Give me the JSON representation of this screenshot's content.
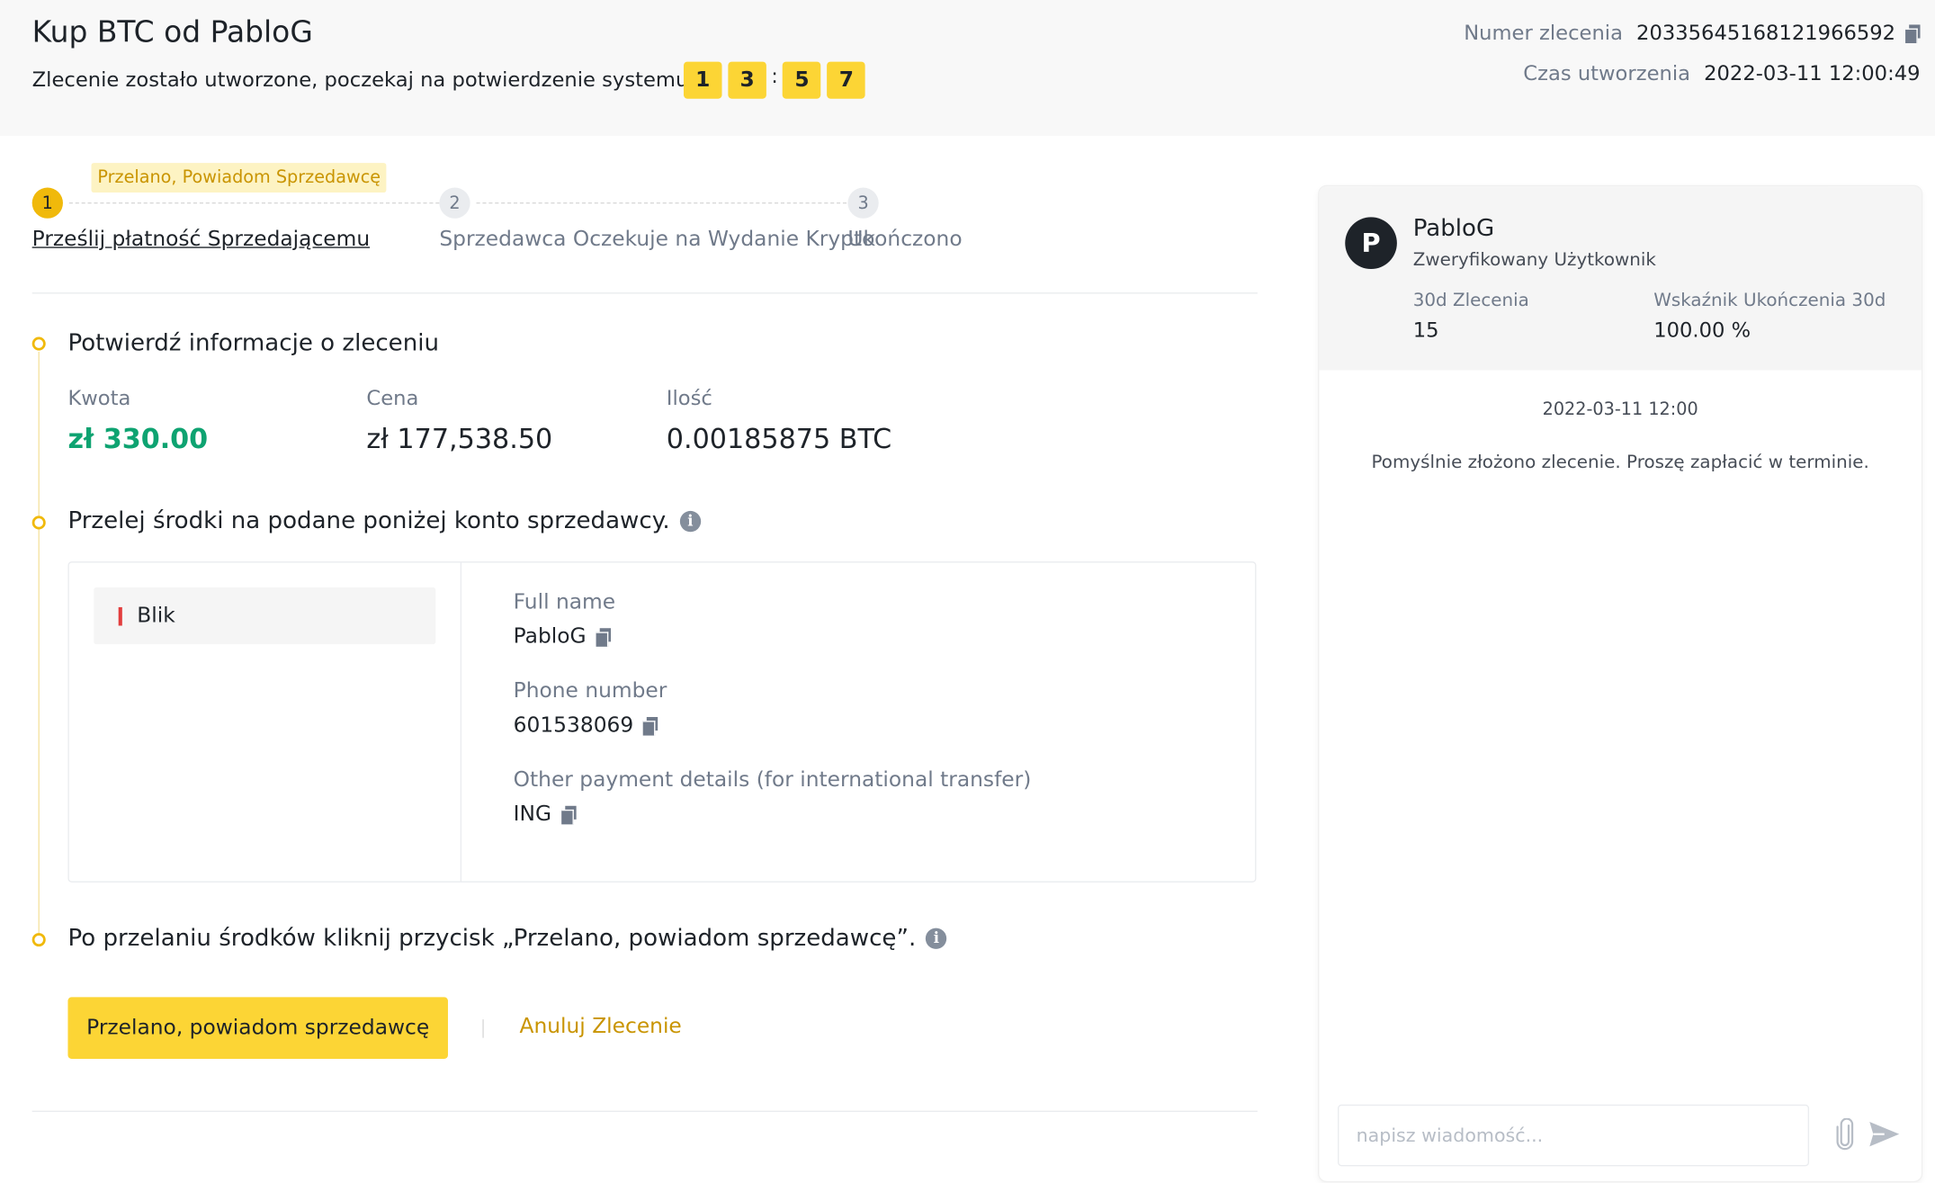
{
  "header": {
    "title": "Kup BTC od PabloG",
    "subtitle": "Zlecenie zostało utworzone, poczekaj na potwierdzenie systemu.",
    "timer": {
      "d1": "1",
      "d2": "3",
      "sep": ":",
      "d3": "5",
      "d4": "7"
    },
    "order_number_label": "Numer zlecenia",
    "order_number": "20335645168121966592",
    "created_label": "Czas utworzenia",
    "created_time": "2022-03-11 12:00:49"
  },
  "steps": {
    "tooltip": "Przelano, Powiadom Sprzedawcę",
    "items": [
      {
        "num": "1",
        "label": "Prześlij płatność Sprzedającemu"
      },
      {
        "num": "2",
        "label": "Sprzedawca Oczekuje na Wydanie Krypto"
      },
      {
        "num": "3",
        "label": "Ukończono"
      }
    ]
  },
  "order_info": {
    "title": "Potwierdź informacje o zleceniu",
    "amount_label": "Kwota",
    "amount": "zł 330.00",
    "price_label": "Cena",
    "price": "zł 177,538.50",
    "qty_label": "Ilość",
    "qty": "0.00185875 BTC"
  },
  "transfer": {
    "title": "Przelej środki na podane poniżej konto sprzedawcy.",
    "method": "Blik",
    "full_name_label": "Full name",
    "full_name": "PabloG",
    "phone_label": "Phone number",
    "phone": "601538069",
    "other_label": "Other payment details (for international transfer)",
    "other": "ING"
  },
  "confirm": {
    "title": "Po przelaniu środków kliknij przycisk „Przelano, powiadom sprzedawcę”.",
    "primary_button": "Przelano, powiadom sprzedawcę",
    "cancel_button": "Anuluj Zlecenie"
  },
  "chat": {
    "avatar_letter": "P",
    "name": "PabloG",
    "verified": "Zweryfikowany Użytkownik",
    "orders_label": "30d Zlecenia",
    "orders_value": "15",
    "rate_label": "Wskaźnik Ukończenia 30d",
    "rate_value": "100.00 %",
    "time": "2022-03-11 12:00",
    "message": "Pomyślnie złożono zlecenie. Proszę zapłacić w terminie.",
    "input_placeholder": "napisz wiadomość..."
  },
  "colors": {
    "accent_yellow": "#fcd535",
    "link_gold": "#c99400",
    "amount_green": "#0ea371",
    "blik_red": "#e23d3d"
  }
}
